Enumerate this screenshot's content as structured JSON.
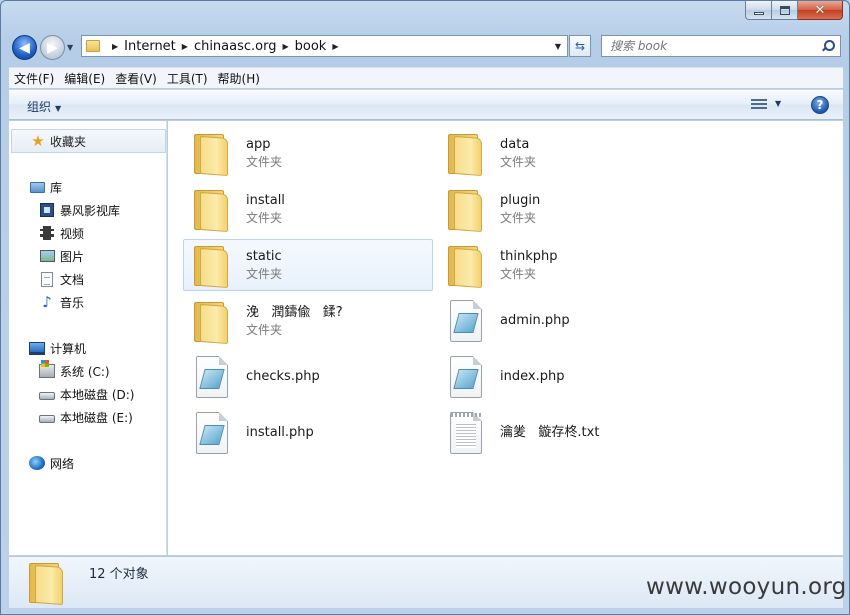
{
  "window": {
    "caption": {
      "minimize": "–",
      "close": "✕"
    }
  },
  "address": {
    "crumbs": [
      "Internet",
      "chinaasc.org",
      "book"
    ]
  },
  "search": {
    "placeholder": "搜索 book"
  },
  "menubar": {
    "items": [
      "文件(F)",
      "编辑(E)",
      "查看(V)",
      "工具(T)",
      "帮助(H)"
    ]
  },
  "commandbar": {
    "organize_label": "组织",
    "help_label": "?"
  },
  "nav": {
    "favorites": "收藏夹",
    "libraries": "库",
    "library_items": [
      "暴风影视库",
      "视频",
      "图片",
      "文档",
      "音乐"
    ],
    "computer": "计算机",
    "drives": [
      "系统 (C:)",
      "本地磁盘 (D:)",
      "本地磁盘 (E:)"
    ],
    "network": "网络"
  },
  "files": [
    {
      "name": "app",
      "type": "文件夹",
      "kind": "folder"
    },
    {
      "name": "data",
      "type": "文件夹",
      "kind": "folder"
    },
    {
      "name": "install",
      "type": "文件夹",
      "kind": "folder"
    },
    {
      "name": "plugin",
      "type": "文件夹",
      "kind": "folder"
    },
    {
      "name": "static",
      "type": "文件夹",
      "kind": "folder"
    },
    {
      "name": "thinkphp",
      "type": "文件夹",
      "kind": "folder"
    },
    {
      "name": "浼   潤鑄偸   鍒?",
      "type": "文件夹",
      "kind": "folder"
    },
    {
      "name": "admin.php",
      "type": "",
      "kind": "php"
    },
    {
      "name": "checks.php",
      "type": "",
      "kind": "php"
    },
    {
      "name": "index.php",
      "type": "",
      "kind": "php"
    },
    {
      "name": "install.php",
      "type": "",
      "kind": "php"
    },
    {
      "name": "瀹夎   鏇存柊.txt",
      "type": "",
      "kind": "txt"
    }
  ],
  "details": {
    "count": "12 个对象"
  },
  "watermark": "www.wooyun.org",
  "colors": {
    "selection": "#e8f1fb",
    "selection_border": "#b8d6f2",
    "accent": "#1e5fc4"
  }
}
